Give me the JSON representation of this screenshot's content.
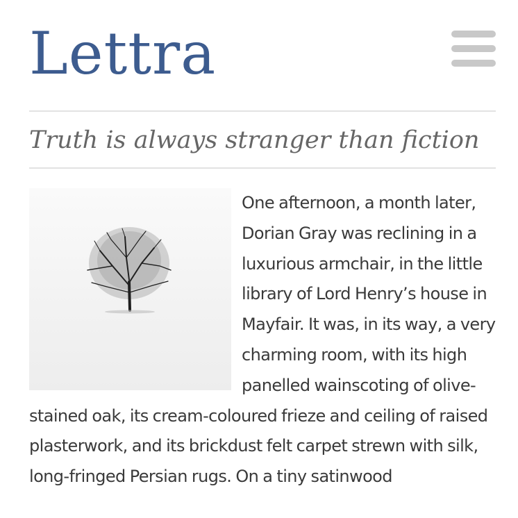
{
  "site": {
    "title": "Lettra",
    "tagline": "Truth is always stranger than fiction"
  },
  "menu": {
    "icon": "hamburger-menu-icon"
  },
  "article": {
    "image_subject": "bare tree in snowy landscape",
    "body": "One afternoon, a month later, Dorian Gray was reclining in a luxurious arm­chair, in the little library of Lord Henry’s house in Mayfair. It was, in its way, a very charming room, with its high panelled wainscoting of olive-stained oak, its cream-coloured frieze and ceiling of raised plasterwork, and its brickdust felt carpet strewn with silk, long-fringed Persian rugs. On a tiny satinwood"
  },
  "colors": {
    "title": "#3d5c8f",
    "tagline": "#666666",
    "body": "#3a3a3a",
    "menu": "#c8c8c8",
    "divider": "#e2e2e2"
  }
}
